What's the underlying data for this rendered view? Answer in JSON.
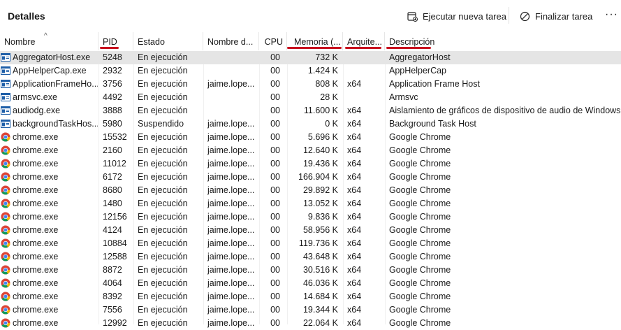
{
  "header": {
    "title": "Detalles",
    "new_task_label": "Ejecutar nueva tarea",
    "end_task_label": "Finalizar tarea",
    "more_label": "···"
  },
  "columns": {
    "name": "Nombre",
    "pid": "PID",
    "state": "Estado",
    "user": "Nombre d...",
    "cpu": "CPU",
    "memory": "Memoria (...",
    "arch": "Arquite...",
    "desc": "Descripción"
  },
  "rows": [
    {
      "icon": "app-window-icon",
      "name": "AggregatorHost.exe",
      "pid": "5248",
      "state": "En ejecución",
      "user": "",
      "cpu": "00",
      "mem": "732 K",
      "arch": "",
      "desc": "AggregatorHost",
      "selected": true
    },
    {
      "icon": "app-window-icon",
      "name": "AppHelperCap.exe",
      "pid": "2932",
      "state": "En ejecución",
      "user": "",
      "cpu": "00",
      "mem": "1.424 K",
      "arch": "",
      "desc": "AppHelperCap",
      "selected": false
    },
    {
      "icon": "app-window-icon",
      "name": "ApplicationFrameHo...",
      "pid": "3756",
      "state": "En ejecución",
      "user": "jaime.lope...",
      "cpu": "00",
      "mem": "808 K",
      "arch": "x64",
      "desc": "Application Frame Host",
      "selected": false
    },
    {
      "icon": "app-window-icon",
      "name": "armsvc.exe",
      "pid": "4492",
      "state": "En ejecución",
      "user": "",
      "cpu": "00",
      "mem": "28 K",
      "arch": "",
      "desc": "Armsvc",
      "selected": false
    },
    {
      "icon": "app-window-icon",
      "name": "audiodg.exe",
      "pid": "3888",
      "state": "En ejecución",
      "user": "",
      "cpu": "00",
      "mem": "11.600 K",
      "arch": "x64",
      "desc": "Aislamiento de gráficos de dispositivo de audio de Windows",
      "selected": false
    },
    {
      "icon": "app-window-icon",
      "name": "backgroundTaskHos...",
      "pid": "5980",
      "state": "Suspendido",
      "user": "jaime.lope...",
      "cpu": "00",
      "mem": "0 K",
      "arch": "x64",
      "desc": "Background Task Host",
      "selected": false
    },
    {
      "icon": "chrome-icon",
      "name": "chrome.exe",
      "pid": "15532",
      "state": "En ejecución",
      "user": "jaime.lope...",
      "cpu": "00",
      "mem": "5.696 K",
      "arch": "x64",
      "desc": "Google Chrome",
      "selected": false
    },
    {
      "icon": "chrome-icon",
      "name": "chrome.exe",
      "pid": "2160",
      "state": "En ejecución",
      "user": "jaime.lope...",
      "cpu": "00",
      "mem": "12.640 K",
      "arch": "x64",
      "desc": "Google Chrome",
      "selected": false
    },
    {
      "icon": "chrome-icon",
      "name": "chrome.exe",
      "pid": "11012",
      "state": "En ejecución",
      "user": "jaime.lope...",
      "cpu": "00",
      "mem": "19.436 K",
      "arch": "x64",
      "desc": "Google Chrome",
      "selected": false
    },
    {
      "icon": "chrome-icon",
      "name": "chrome.exe",
      "pid": "6172",
      "state": "En ejecución",
      "user": "jaime.lope...",
      "cpu": "00",
      "mem": "166.904 K",
      "arch": "x64",
      "desc": "Google Chrome",
      "selected": false
    },
    {
      "icon": "chrome-icon",
      "name": "chrome.exe",
      "pid": "8680",
      "state": "En ejecución",
      "user": "jaime.lope...",
      "cpu": "00",
      "mem": "29.892 K",
      "arch": "x64",
      "desc": "Google Chrome",
      "selected": false
    },
    {
      "icon": "chrome-icon",
      "name": "chrome.exe",
      "pid": "1480",
      "state": "En ejecución",
      "user": "jaime.lope...",
      "cpu": "00",
      "mem": "13.052 K",
      "arch": "x64",
      "desc": "Google Chrome",
      "selected": false
    },
    {
      "icon": "chrome-icon",
      "name": "chrome.exe",
      "pid": "12156",
      "state": "En ejecución",
      "user": "jaime.lope...",
      "cpu": "00",
      "mem": "9.836 K",
      "arch": "x64",
      "desc": "Google Chrome",
      "selected": false
    },
    {
      "icon": "chrome-icon",
      "name": "chrome.exe",
      "pid": "4124",
      "state": "En ejecución",
      "user": "jaime.lope...",
      "cpu": "00",
      "mem": "58.956 K",
      "arch": "x64",
      "desc": "Google Chrome",
      "selected": false
    },
    {
      "icon": "chrome-icon",
      "name": "chrome.exe",
      "pid": "10884",
      "state": "En ejecución",
      "user": "jaime.lope...",
      "cpu": "00",
      "mem": "119.736 K",
      "arch": "x64",
      "desc": "Google Chrome",
      "selected": false
    },
    {
      "icon": "chrome-icon",
      "name": "chrome.exe",
      "pid": "12588",
      "state": "En ejecución",
      "user": "jaime.lope...",
      "cpu": "00",
      "mem": "43.648 K",
      "arch": "x64",
      "desc": "Google Chrome",
      "selected": false
    },
    {
      "icon": "chrome-icon",
      "name": "chrome.exe",
      "pid": "8872",
      "state": "En ejecución",
      "user": "jaime.lope...",
      "cpu": "00",
      "mem": "30.516 K",
      "arch": "x64",
      "desc": "Google Chrome",
      "selected": false
    },
    {
      "icon": "chrome-icon",
      "name": "chrome.exe",
      "pid": "4064",
      "state": "En ejecución",
      "user": "jaime.lope...",
      "cpu": "00",
      "mem": "46.036 K",
      "arch": "x64",
      "desc": "Google Chrome",
      "selected": false
    },
    {
      "icon": "chrome-icon",
      "name": "chrome.exe",
      "pid": "8392",
      "state": "En ejecución",
      "user": "jaime.lope...",
      "cpu": "00",
      "mem": "14.684 K",
      "arch": "x64",
      "desc": "Google Chrome",
      "selected": false
    },
    {
      "icon": "chrome-icon",
      "name": "chrome.exe",
      "pid": "7556",
      "state": "En ejecución",
      "user": "jaime.lope...",
      "cpu": "00",
      "mem": "19.344 K",
      "arch": "x64",
      "desc": "Google Chrome",
      "selected": false
    },
    {
      "icon": "chrome-icon",
      "name": "chrome.exe",
      "pid": "12992",
      "state": "En ejecución",
      "user": "jaime.lope...",
      "cpu": "00",
      "mem": "22.064 K",
      "arch": "x64",
      "desc": "Google Chrome",
      "selected": false
    }
  ],
  "colors": {
    "annotation": "#c8101e",
    "selected_row": "#e5e5e5",
    "app_icon": "#1f5fa8"
  }
}
